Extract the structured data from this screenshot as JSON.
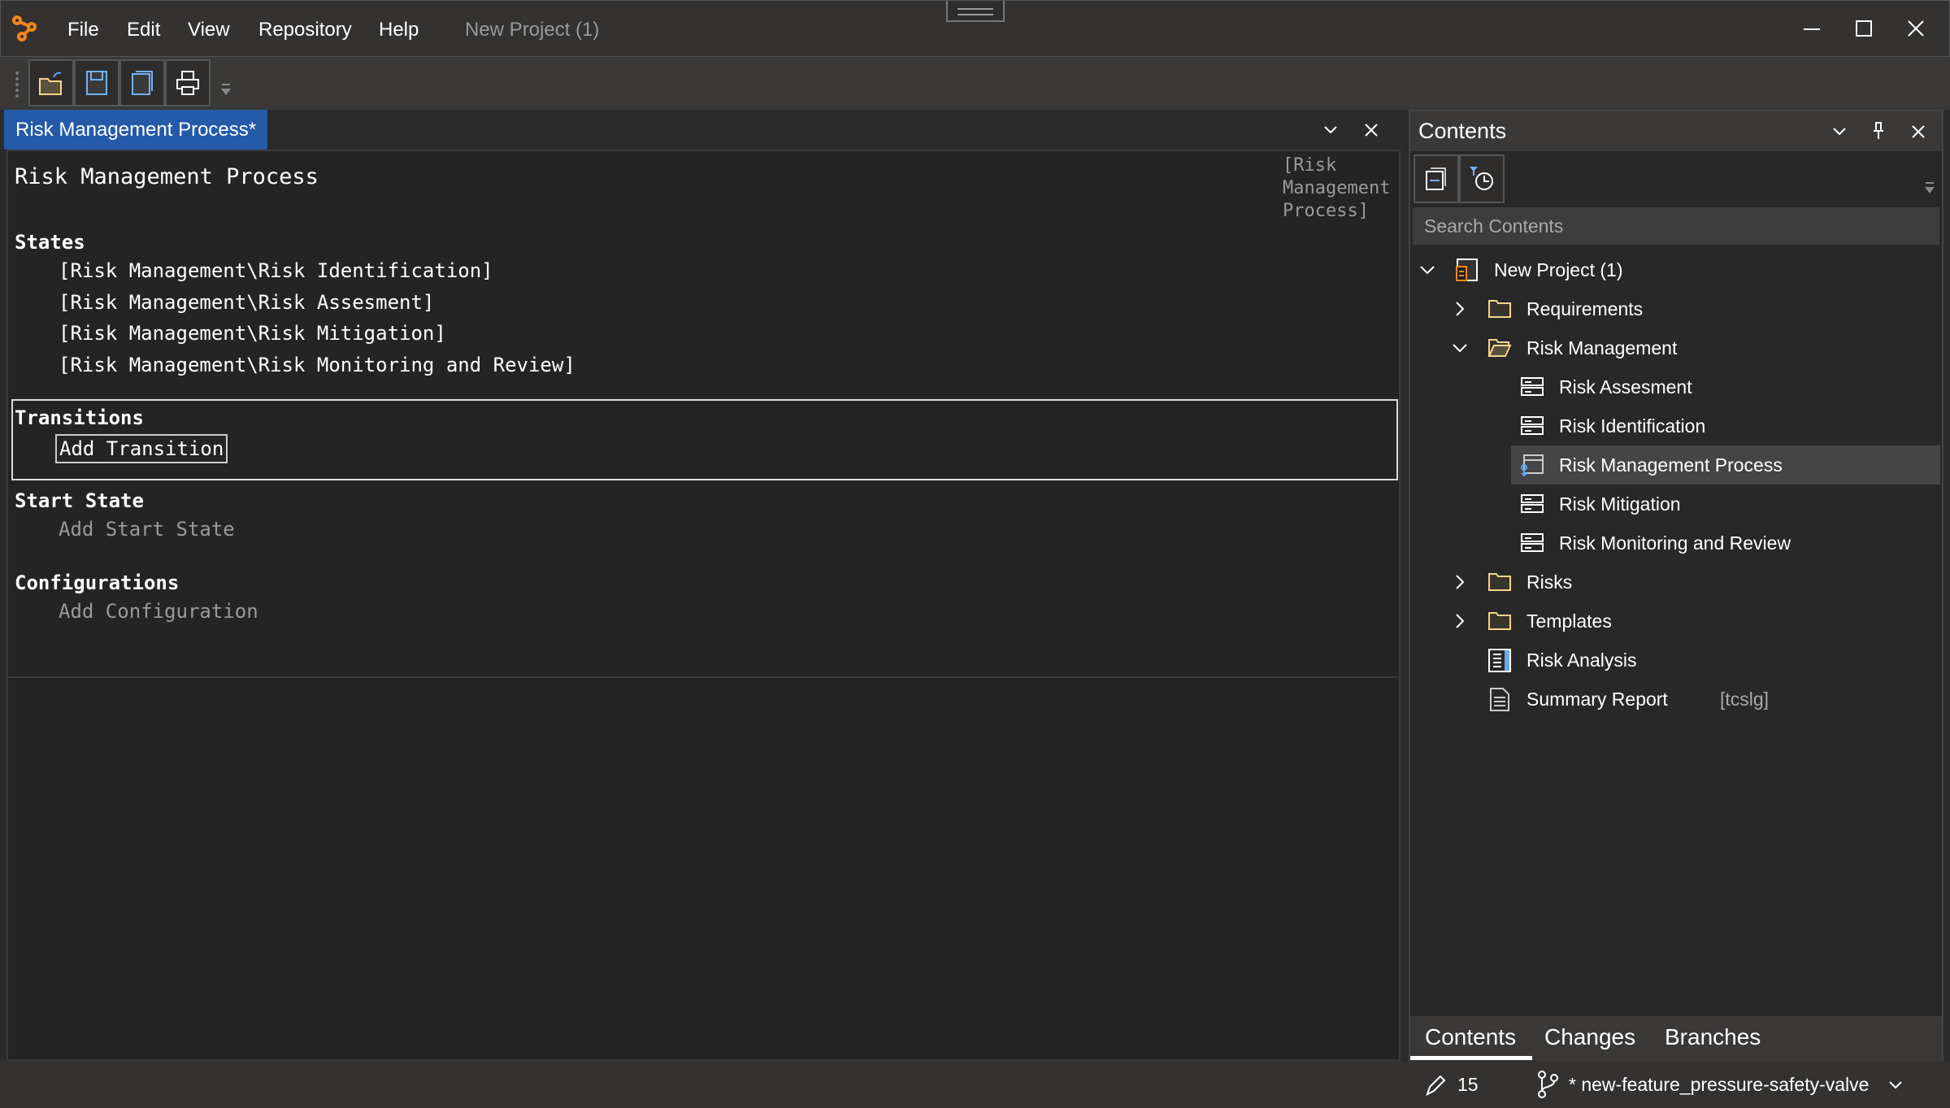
{
  "app": {
    "menu": [
      "File",
      "Edit",
      "View",
      "Repository",
      "Help"
    ],
    "title": "New Project (1)",
    "accent": "#245aa8",
    "logo_color": "#f0861c"
  },
  "toolbar": {
    "buttons": [
      {
        "icon": "open-folder-icon",
        "label": "Open"
      },
      {
        "icon": "save-icon",
        "label": "Save"
      },
      {
        "icon": "save-all-icon",
        "label": "Save All"
      },
      {
        "icon": "print-icon",
        "label": "Print"
      }
    ]
  },
  "document": {
    "tab_label": "Risk Management Process*",
    "title": "Risk Management Process",
    "side_ref": "[Risk\nManagement\nProcess]",
    "states_header": "States",
    "states": [
      "[Risk Management\\Risk Identification]",
      "[Risk Management\\Risk Assesment]",
      "[Risk Management\\Risk Mitigation]",
      "[Risk Management\\Risk Monitoring and Review]"
    ],
    "transitions_header": "Transitions",
    "add_transition": "Add Transition",
    "start_state_header": "Start State",
    "add_start_state": "Add Start State",
    "configurations_header": "Configurations",
    "add_configuration": "Add Configuration"
  },
  "contents": {
    "title": "Contents",
    "search_placeholder": "Search Contents",
    "tree": [
      {
        "label": "New Project (1)",
        "level": 0,
        "chevron": "down",
        "icon": "project-icon"
      },
      {
        "label": "Requirements",
        "level": 1,
        "chevron": "right",
        "icon": "folder-icon"
      },
      {
        "label": "Risk Management",
        "level": 1,
        "chevron": "down",
        "icon": "folder-open-icon"
      },
      {
        "label": "Risk Assesment",
        "level": 2,
        "icon": "state-icon"
      },
      {
        "label": "Risk Identification",
        "level": 2,
        "icon": "state-icon"
      },
      {
        "label": "Risk Management Process",
        "level": 2,
        "icon": "process-icon",
        "selected": true
      },
      {
        "label": "Risk Mitigation",
        "level": 2,
        "icon": "state-icon"
      },
      {
        "label": "Risk Monitoring and Review",
        "level": 2,
        "icon": "state-icon"
      },
      {
        "label": "Risks",
        "level": 1,
        "chevron": "right",
        "icon": "folder-icon"
      },
      {
        "label": "Templates",
        "level": 1,
        "chevron": "right",
        "icon": "folder-icon"
      },
      {
        "label": "Risk Analysis",
        "level": 1,
        "icon": "table-doc-icon"
      },
      {
        "label": "Summary Report",
        "level": 1,
        "icon": "document-icon",
        "tag": "[tcslg]"
      }
    ],
    "bottom_tabs": [
      "Contents",
      "Changes",
      "Branches"
    ],
    "active_bottom_tab": "Contents"
  },
  "status": {
    "changes_count": "15",
    "branch": "* new-feature_pressure-safety-valve"
  }
}
